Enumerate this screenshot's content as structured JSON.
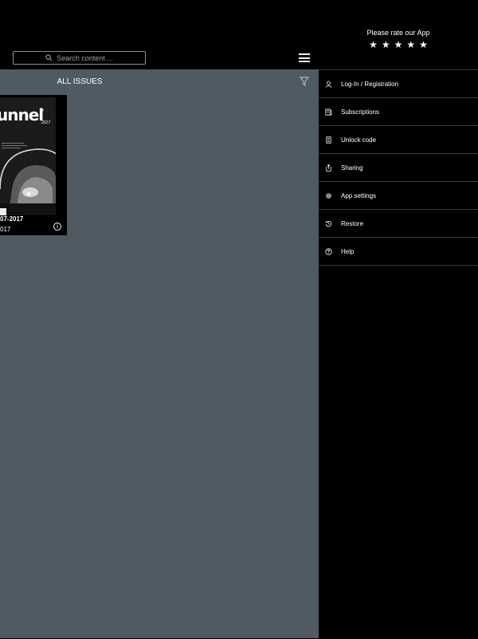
{
  "header": {
    "search_placeholder": "Search content ...",
    "rate_text": "Please rate our App",
    "stars": "★★★★★"
  },
  "main": {
    "title": "ALL ISSUES",
    "background": "#4f5a62"
  },
  "issue": {
    "cover_title": "unnel",
    "cover_number": "7",
    "cover_year": "2017",
    "label_line1": "07-2017",
    "label_line2": "017",
    "info_glyph": "i"
  },
  "menu": {
    "items": [
      {
        "label": "Log-In / Registration",
        "icon": "user-icon"
      },
      {
        "label": "Subscriptions",
        "icon": "subscriptions-icon"
      },
      {
        "label": "Unlock code",
        "icon": "code-icon"
      },
      {
        "label": "Sharing",
        "icon": "share-icon"
      },
      {
        "label": "App settings",
        "icon": "gear-icon"
      },
      {
        "label": "Restore",
        "icon": "restore-icon"
      },
      {
        "label": "Help",
        "icon": "help-icon"
      }
    ]
  }
}
